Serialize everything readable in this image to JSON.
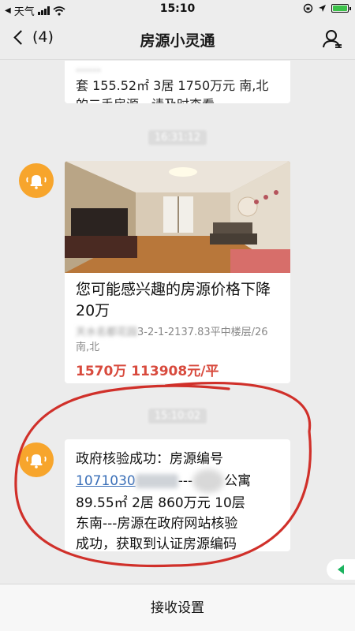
{
  "status_bar": {
    "back_app": "天气",
    "time": "15:10"
  },
  "nav": {
    "back_label": "(4)",
    "title": "房源小灵通"
  },
  "messages": [
    {
      "type": "text",
      "line1_partial": "……",
      "line2": "套 155.52㎡ 3居 1750万元 南,北",
      "line3": "的二手房源，请及时查看。"
    },
    {
      "type": "listing",
      "timestamp": "16:31:12",
      "title": "您可能感兴趣的房源价格下降20万",
      "addr_blurred": "天水名都花园",
      "addr_visible": "3-2-1-2137.83平中楼层/26南,北",
      "price": "1570万 113908元/平"
    },
    {
      "type": "text",
      "timestamp": "15:10:02",
      "line1": "政府核验成功：房源编号",
      "id_visible": "1071030",
      "sep": "---",
      "kind": "公寓",
      "line3": "89.55㎡ 2居 860万元 10层",
      "line4": "东南---房源在政府网站核验",
      "line5": "成功，获取到认证房源编码"
    }
  ],
  "bottom": {
    "label": "接收设置"
  },
  "colors": {
    "bell": "#f7a52c",
    "price": "#d84a3d",
    "link": "#3a6fb8",
    "annotation": "#d0302a"
  }
}
